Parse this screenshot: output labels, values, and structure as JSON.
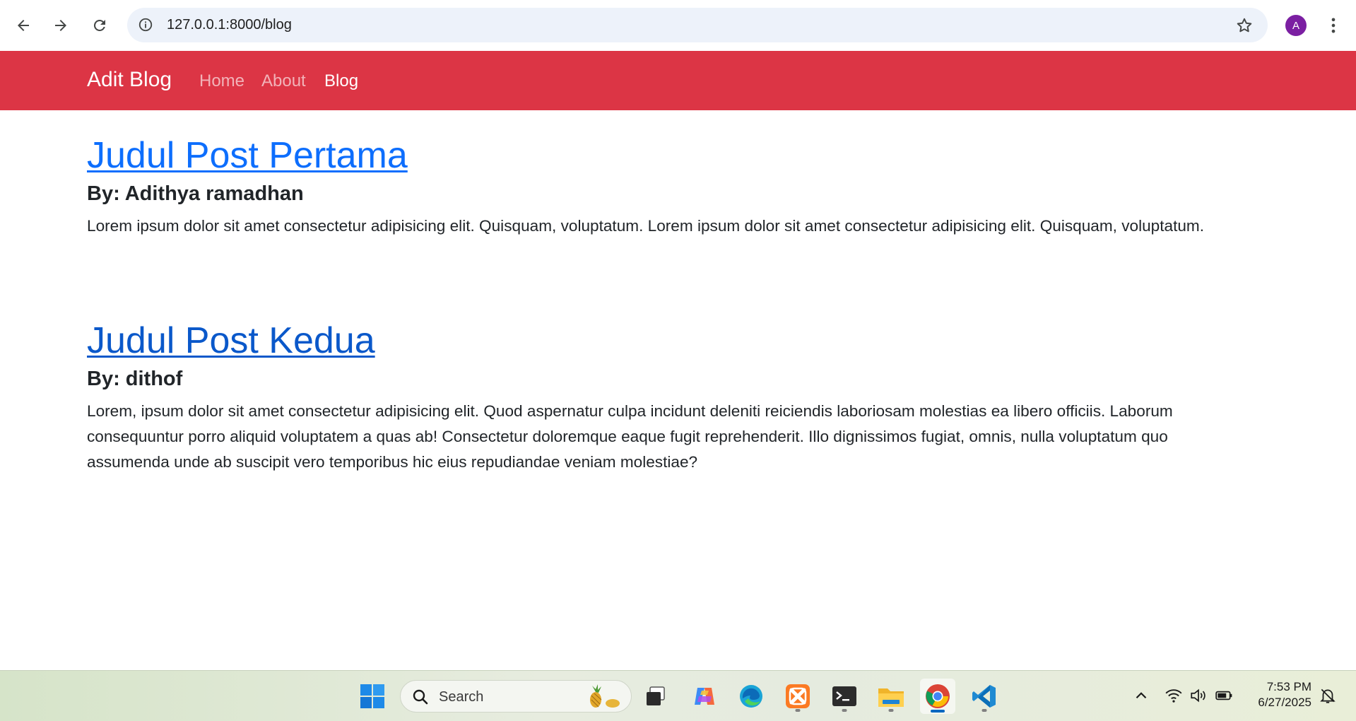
{
  "browser": {
    "url": "127.0.0.1:8000/blog",
    "profile_initial": "A",
    "icons": [
      "back-icon",
      "forward-icon",
      "reload-icon",
      "info-icon",
      "star-icon",
      "kebab-menu-icon"
    ]
  },
  "navbar": {
    "brand": "Adit Blog",
    "links": [
      {
        "label": "Home",
        "active": false
      },
      {
        "label": "About",
        "active": false
      },
      {
        "label": "Blog",
        "active": true
      }
    ],
    "color": "#dc3545"
  },
  "posts": [
    {
      "title": "Judul Post Pertama",
      "author": "By: Adithya ramadhan",
      "body": "Lorem ipsum dolor sit amet consectetur adipisicing elit. Quisquam, voluptatum. Lorem ipsum dolor sit amet consectetur adipisicing elit. Quisquam, voluptatum."
    },
    {
      "title": "Judul Post Kedua",
      "author": "By: dithof",
      "body": "Lorem, ipsum dolor sit amet consectetur adipisicing elit. Quod aspernatur culpa incidunt deleniti reiciendis laboriosam molestias ea libero officiis. Laborum consequuntur porro aliquid voluptatem a quas ab! Consectetur doloremque eaque fugit reprehenderit. Illo dignissimos fugiat, omnis, nulla voluptatum quo assumenda unde ab suscipit vero temporibus hic eius repudiandae veniam molestiae?"
    }
  ],
  "taskbar": {
    "search_label": "Search",
    "time": "7:53 PM",
    "date": "6/27/2025",
    "apps": [
      "windows-start",
      "task-view",
      "copilot",
      "edge",
      "xampp",
      "terminal",
      "file-explorer",
      "chrome",
      "vscode"
    ]
  }
}
